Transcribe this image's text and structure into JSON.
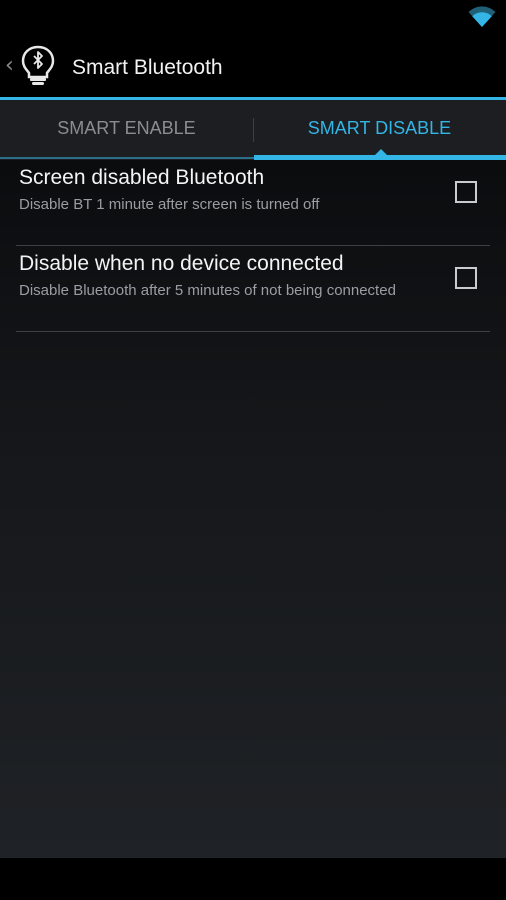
{
  "status_bar": {
    "wifi_icon": "wifi-icon",
    "wifi_color": "#33b5e5"
  },
  "action_bar": {
    "up_icon": "chevron-left-icon",
    "up_glyph": "‹",
    "app_icon": "bluetooth-lightbulb-icon",
    "title": "Smart Bluetooth"
  },
  "tabs": [
    {
      "label": "SMART ENABLE",
      "selected": false
    },
    {
      "label": "SMART DISABLE",
      "selected": true
    }
  ],
  "preferences": [
    {
      "title": "Screen disabled Bluetooth",
      "summary": "Disable BT 1 minute after screen is turned off",
      "checked": false
    },
    {
      "title": "Disable when no device connected",
      "summary": "Disable Bluetooth after 5 minutes of not being connected",
      "checked": false
    }
  ],
  "colors": {
    "accent": "#33b5e5",
    "text_primary": "#f4f4f4",
    "text_secondary": "#9a9da2",
    "tab_inactive": "#8a8d91"
  }
}
